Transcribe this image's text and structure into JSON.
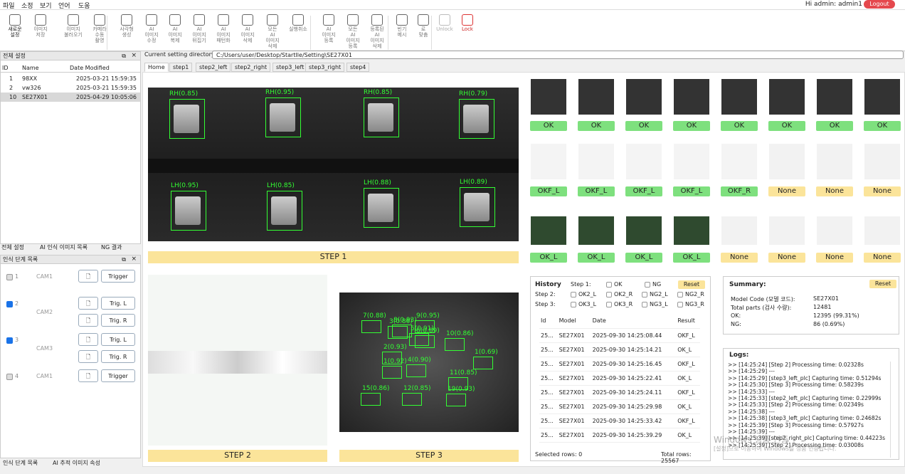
{
  "menu": [
    "파일",
    "소정",
    "보기",
    "언어",
    "도움"
  ],
  "user": {
    "greeting": "Hi admin: admin1",
    "logout": "Logout"
  },
  "toolbar": [
    {
      "label": "새로운\n설정",
      "icon": "plus-icon",
      "bold": true
    },
    {
      "label": "이미지\n저장",
      "icon": "save-icon"
    },
    {
      "label": "이미지\n불러오기",
      "icon": "expand-icon"
    },
    {
      "label": "카메라\n수동\n촬영",
      "icon": "video-icon"
    },
    {
      "label": "사각형\n생성",
      "icon": "rect-tag-icon"
    },
    {
      "label": "AI\n이미지\n수정",
      "icon": "ai-edit-icon"
    },
    {
      "label": "AI\n이미지\n복제",
      "icon": "copy-icon"
    },
    {
      "label": "AI\n이미지\n뒤집기",
      "icon": "flip-icon"
    },
    {
      "label": "AI\n이미지\n패턴화",
      "icon": "grid-icon"
    },
    {
      "label": "AI\n이미지\n삭제",
      "icon": "delete-icon"
    },
    {
      "label": "모든\nAI\n이미지\n삭제",
      "icon": "eraser-icon"
    },
    {
      "label": "실행취소",
      "icon": "undo-icon"
    },
    {
      "label": "AI\n이미지\n등록",
      "icon": "register-icon"
    },
    {
      "label": "모든\nAI\n이미지\n등록",
      "icon": "register-all-icon"
    },
    {
      "label": "등록된\nAI\n이미지\n삭제",
      "icon": "remove-registered-icon"
    },
    {
      "label": "빈기\n메시",
      "icon": "loading-icon"
    },
    {
      "label": "로\n맞춤",
      "icon": "zoom-icon"
    },
    {
      "label": "Unlock",
      "icon": "unlock-icon"
    },
    {
      "label": "Lock",
      "icon": "lock-icon"
    }
  ],
  "settings": {
    "title": "전체 설정",
    "cols": [
      "ID",
      "Name",
      "Date Modified"
    ],
    "rows": [
      [
        "1",
        "98XX",
        "2025-03-21 15:59:35"
      ],
      [
        "2",
        "vw326",
        "2025-03-21 15:59:35"
      ],
      [
        "10",
        "SE27X01",
        "2025-04-29 10:05:06"
      ]
    ],
    "tabs": [
      "전체 설정",
      "AI 인식 이미지 목록",
      "NG 결과"
    ]
  },
  "steps_panel": {
    "title": "인식 단계 목록",
    "cams": [
      {
        "num": "1",
        "cam": "CAM1",
        "checked": false,
        "buttons": [
          "Trigger"
        ]
      },
      {
        "num": "2",
        "cam": "CAM2",
        "checked": true,
        "buttons": [
          "Trig. L",
          "Trig. R"
        ]
      },
      {
        "num": "3",
        "cam": "CAM3",
        "checked": true,
        "buttons": [
          "Trig. L",
          "Trig. R"
        ]
      },
      {
        "num": "4",
        "cam": "CAM1",
        "checked": false,
        "buttons": [
          "Trigger"
        ]
      }
    ],
    "tabs": [
      "인식 단계 목록",
      "AI 추적 이미지 속성"
    ]
  },
  "directory": {
    "label": "Current setting directory",
    "path": "C:/Users/user/Desktop/StartIle/Setting\\SE27X01"
  },
  "tabs": [
    "Home",
    "step1",
    "step2_left",
    "step2_right",
    "step3_left",
    "step3_right",
    "step4"
  ],
  "step1": {
    "title": "STEP 1",
    "boxes": [
      "RH(0.85)",
      "RH(0.95)",
      "RH(0.85)",
      "RH(0.79)",
      "LH(0.95)",
      "LH(0.85)",
      "LH(0.88)",
      "LH(0.89)"
    ]
  },
  "step2": {
    "title": "STEP 2"
  },
  "step3": {
    "title": "STEP 3",
    "labels": [
      "7(0.88)",
      "8(0.93)",
      "9(0.95)",
      "3(0.86)",
      "5(0.91)",
      "6(0.89)",
      "10(0.86)",
      "2(0.93)",
      "1(0.69)",
      "4(0.90)",
      "1(0.92)",
      "11(0.85)",
      "15(0.86)",
      "12(0.85)",
      "19(0.93)"
    ]
  },
  "results": {
    "row1": [
      "OK",
      "OK",
      "OK",
      "OK",
      "OK",
      "OK",
      "OK",
      "OK"
    ],
    "row2": [
      "OKF_L",
      "OKF_L",
      "OKF_L",
      "OKF_L",
      "OKF_R",
      "None",
      "None",
      "None"
    ],
    "row3": [
      "OK_L",
      "OK_L",
      "OK_L",
      "OK_L",
      "None",
      "None",
      "None",
      "None"
    ]
  },
  "history": {
    "title": "History",
    "reset": "Reset",
    "filters": [
      [
        "Step 1:",
        [
          "OK",
          "NG"
        ]
      ],
      [
        "Step 2:",
        [
          "OK2_L",
          "OK2_R",
          "NG2_L",
          "NG2_R"
        ]
      ],
      [
        "Step 3:",
        [
          "OK3_L",
          "OK3_R",
          "NG3_L",
          "NG3_R"
        ]
      ]
    ],
    "cols": [
      "Id",
      "Model",
      "Date",
      "Result"
    ],
    "rows": [
      [
        "25...",
        "SE27X01",
        "2025-09-30 14:25:08.44",
        "OKF_L"
      ],
      [
        "25...",
        "SE27X01",
        "2025-09-30 14:25:14.21",
        "OK_L"
      ],
      [
        "25...",
        "SE27X01",
        "2025-09-30 14:25:16.45",
        "OKF_L"
      ],
      [
        "25...",
        "SE27X01",
        "2025-09-30 14:25:22.41",
        "OK_L"
      ],
      [
        "25...",
        "SE27X01",
        "2025-09-30 14:25:24.11",
        "OKF_L"
      ],
      [
        "25...",
        "SE27X01",
        "2025-09-30 14:25:29.98",
        "OK_L"
      ],
      [
        "25...",
        "SE27X01",
        "2025-09-30 14:25:33.42",
        "OKF_L"
      ],
      [
        "25...",
        "SE27X01",
        "2025-09-30 14:25:39.29",
        "OK_L"
      ]
    ],
    "selected": "Selected rows: 0",
    "total": "Total rows: 25567"
  },
  "summary": {
    "title": "Summary:",
    "reset": "Reset",
    "lines": [
      [
        "Model Code (모델 코드):",
        "SE27X01"
      ],
      [
        "Total parts (검사 수량):",
        "12481"
      ],
      [
        "OK:",
        "12395 (99.31%)"
      ],
      [
        "NG:",
        "86 (0.69%)"
      ]
    ]
  },
  "logs": {
    "title": "Logs:",
    "lines": [
      ">> [14:25:24] [Step 2] Processing time: 0.02328s",
      ">> [14:25:29] ---",
      ">> [14:25:29] [step3_left_plc] Capturing time: 0.51294s",
      ">> [14:25:30] [Step 3] Processing time: 0.58239s",
      ">> [14:25:33] ---",
      ">> [14:25:33] [step2_left_plc] Capturing time: 0.22999s",
      ">> [14:25:33] [Step 2] Processing time: 0.02349s",
      ">> [14:25:38] ---",
      ">> [14:25:38] [step3_left_plc] Capturing time: 0.24682s",
      ">> [14:25:39] [Step 3] Processing time: 0.57927s",
      ">> [14:25:39] ---",
      ">> [14:25:39] [step2_right_plc] Capturing time: 0.44223s",
      ">> [14:25:39] [Step 2] Processing time: 0.03008s"
    ]
  },
  "watermark": {
    "line1": "Windows 정품 인증",
    "line2": "[설정]으로 이동하여 Windows를 정품 인증합니다."
  }
}
